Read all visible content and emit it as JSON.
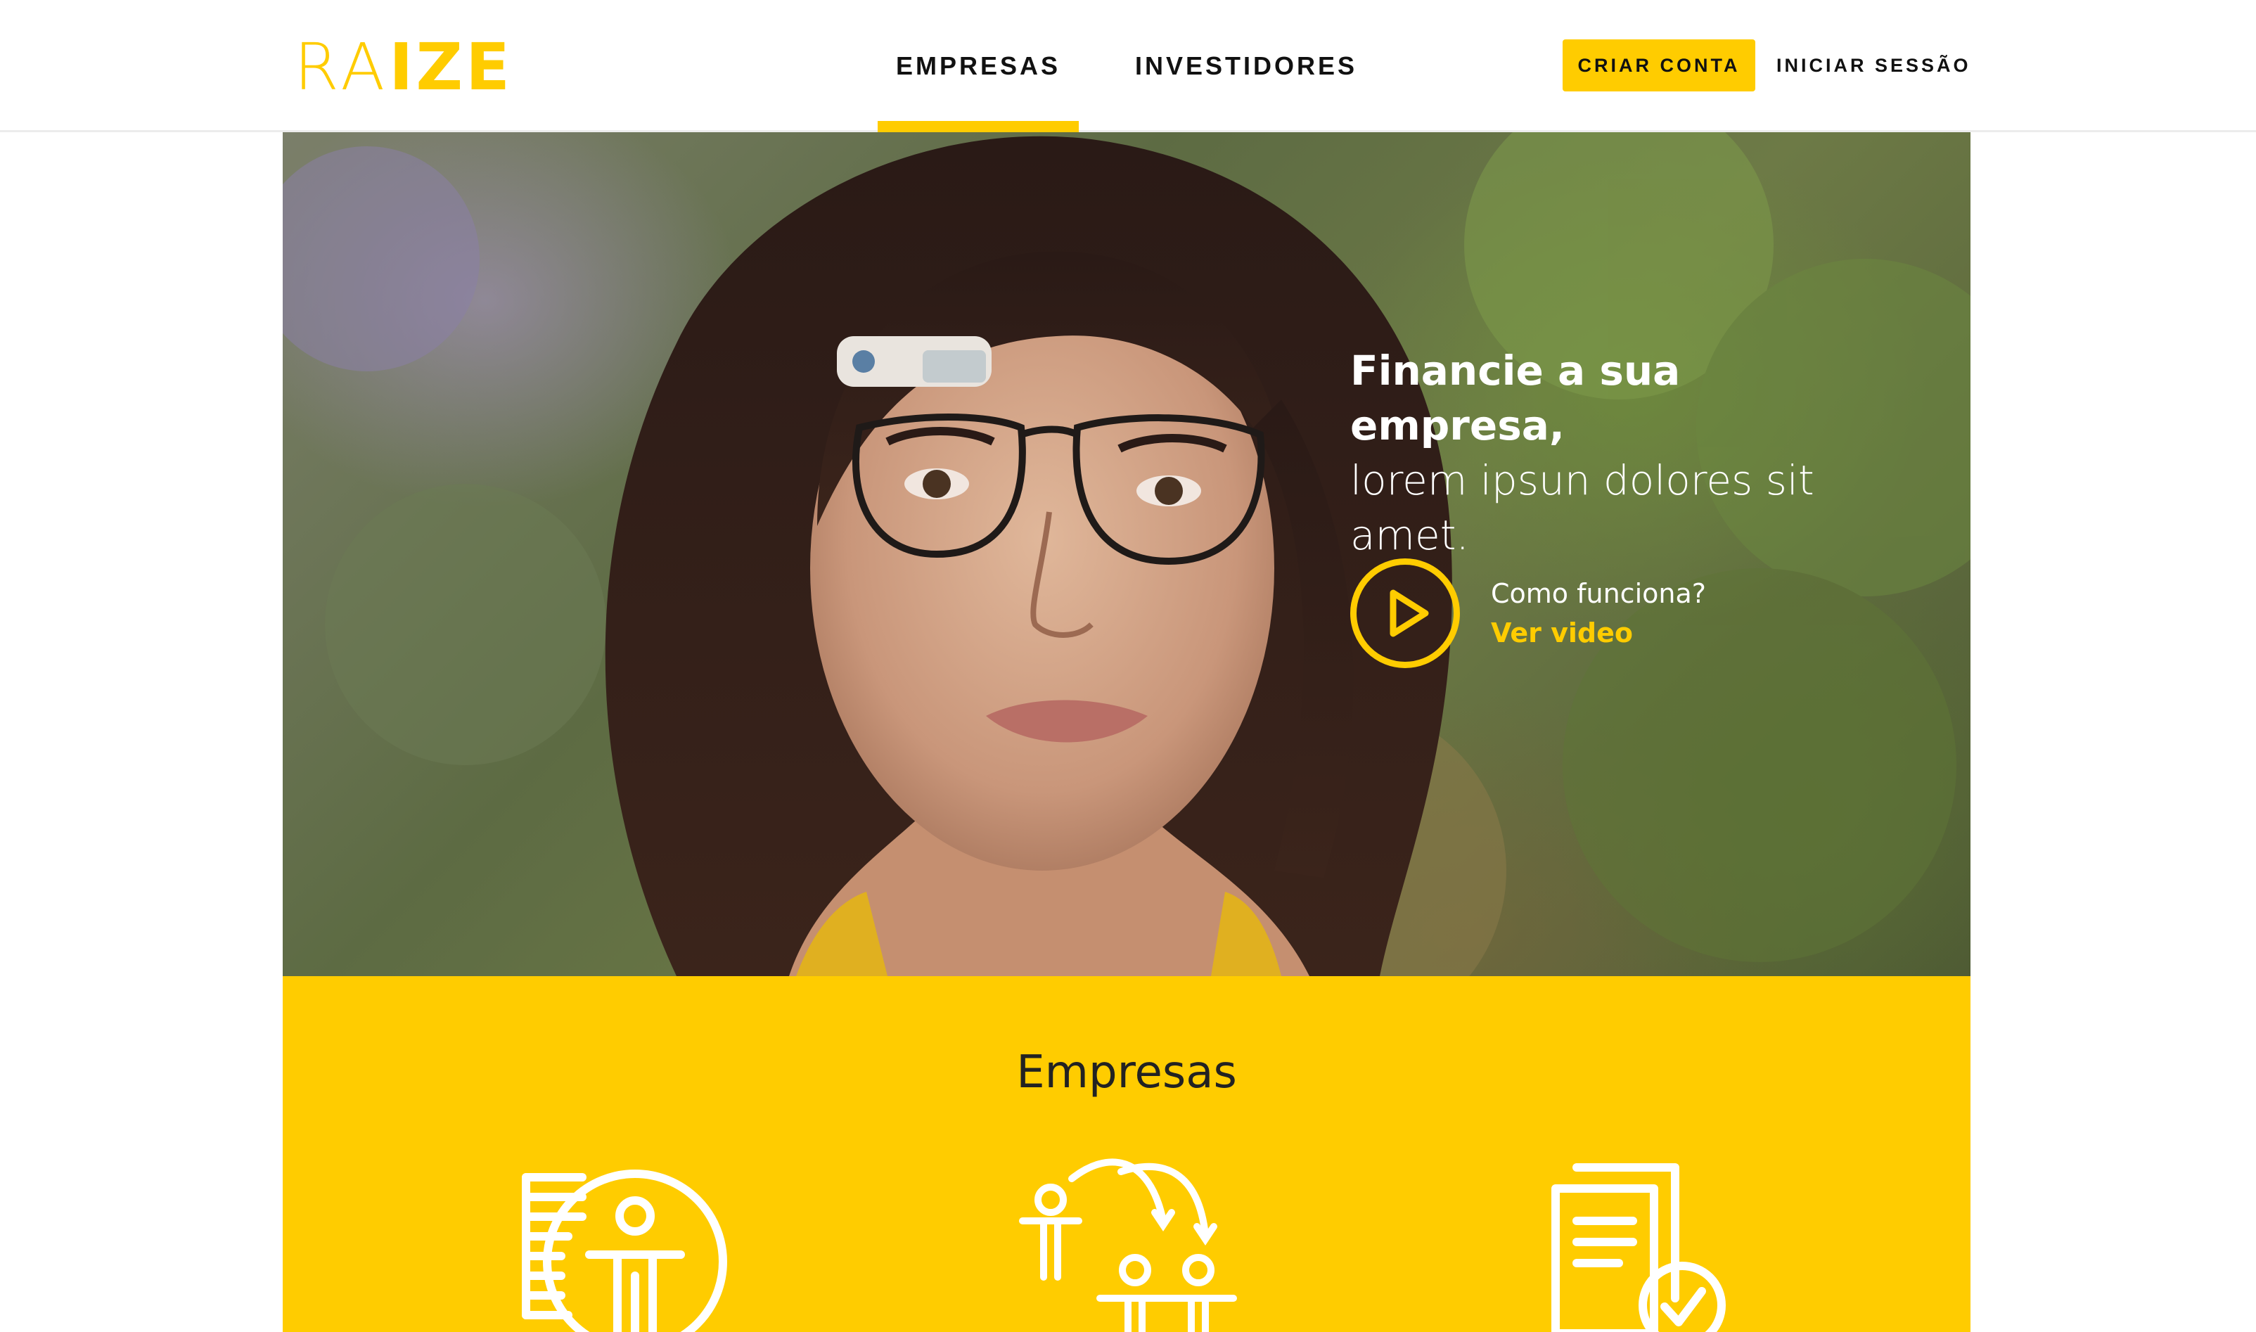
{
  "header": {
    "logo": {
      "thin": "RA",
      "bold": "IZE"
    },
    "nav": [
      {
        "label": "EMPRESAS",
        "active": true
      },
      {
        "label": "INVESTIDORES",
        "active": false
      }
    ],
    "cta_label": "CRIAR CONTA",
    "login_label": "INICIAR SESSÃO"
  },
  "hero": {
    "headline_bold": "Financie a sua empresa,",
    "headline_line2": "lorem ipsun dolores sit",
    "headline_line3": "amet.",
    "video_question": "Como funciona?",
    "video_link": "Ver video"
  },
  "section": {
    "title": "Empresas",
    "icons": [
      "person-coins-icon",
      "people-exchange-icon",
      "documents-check-icon"
    ]
  },
  "colors": {
    "accent": "#ffcc00",
    "text": "#111111"
  }
}
